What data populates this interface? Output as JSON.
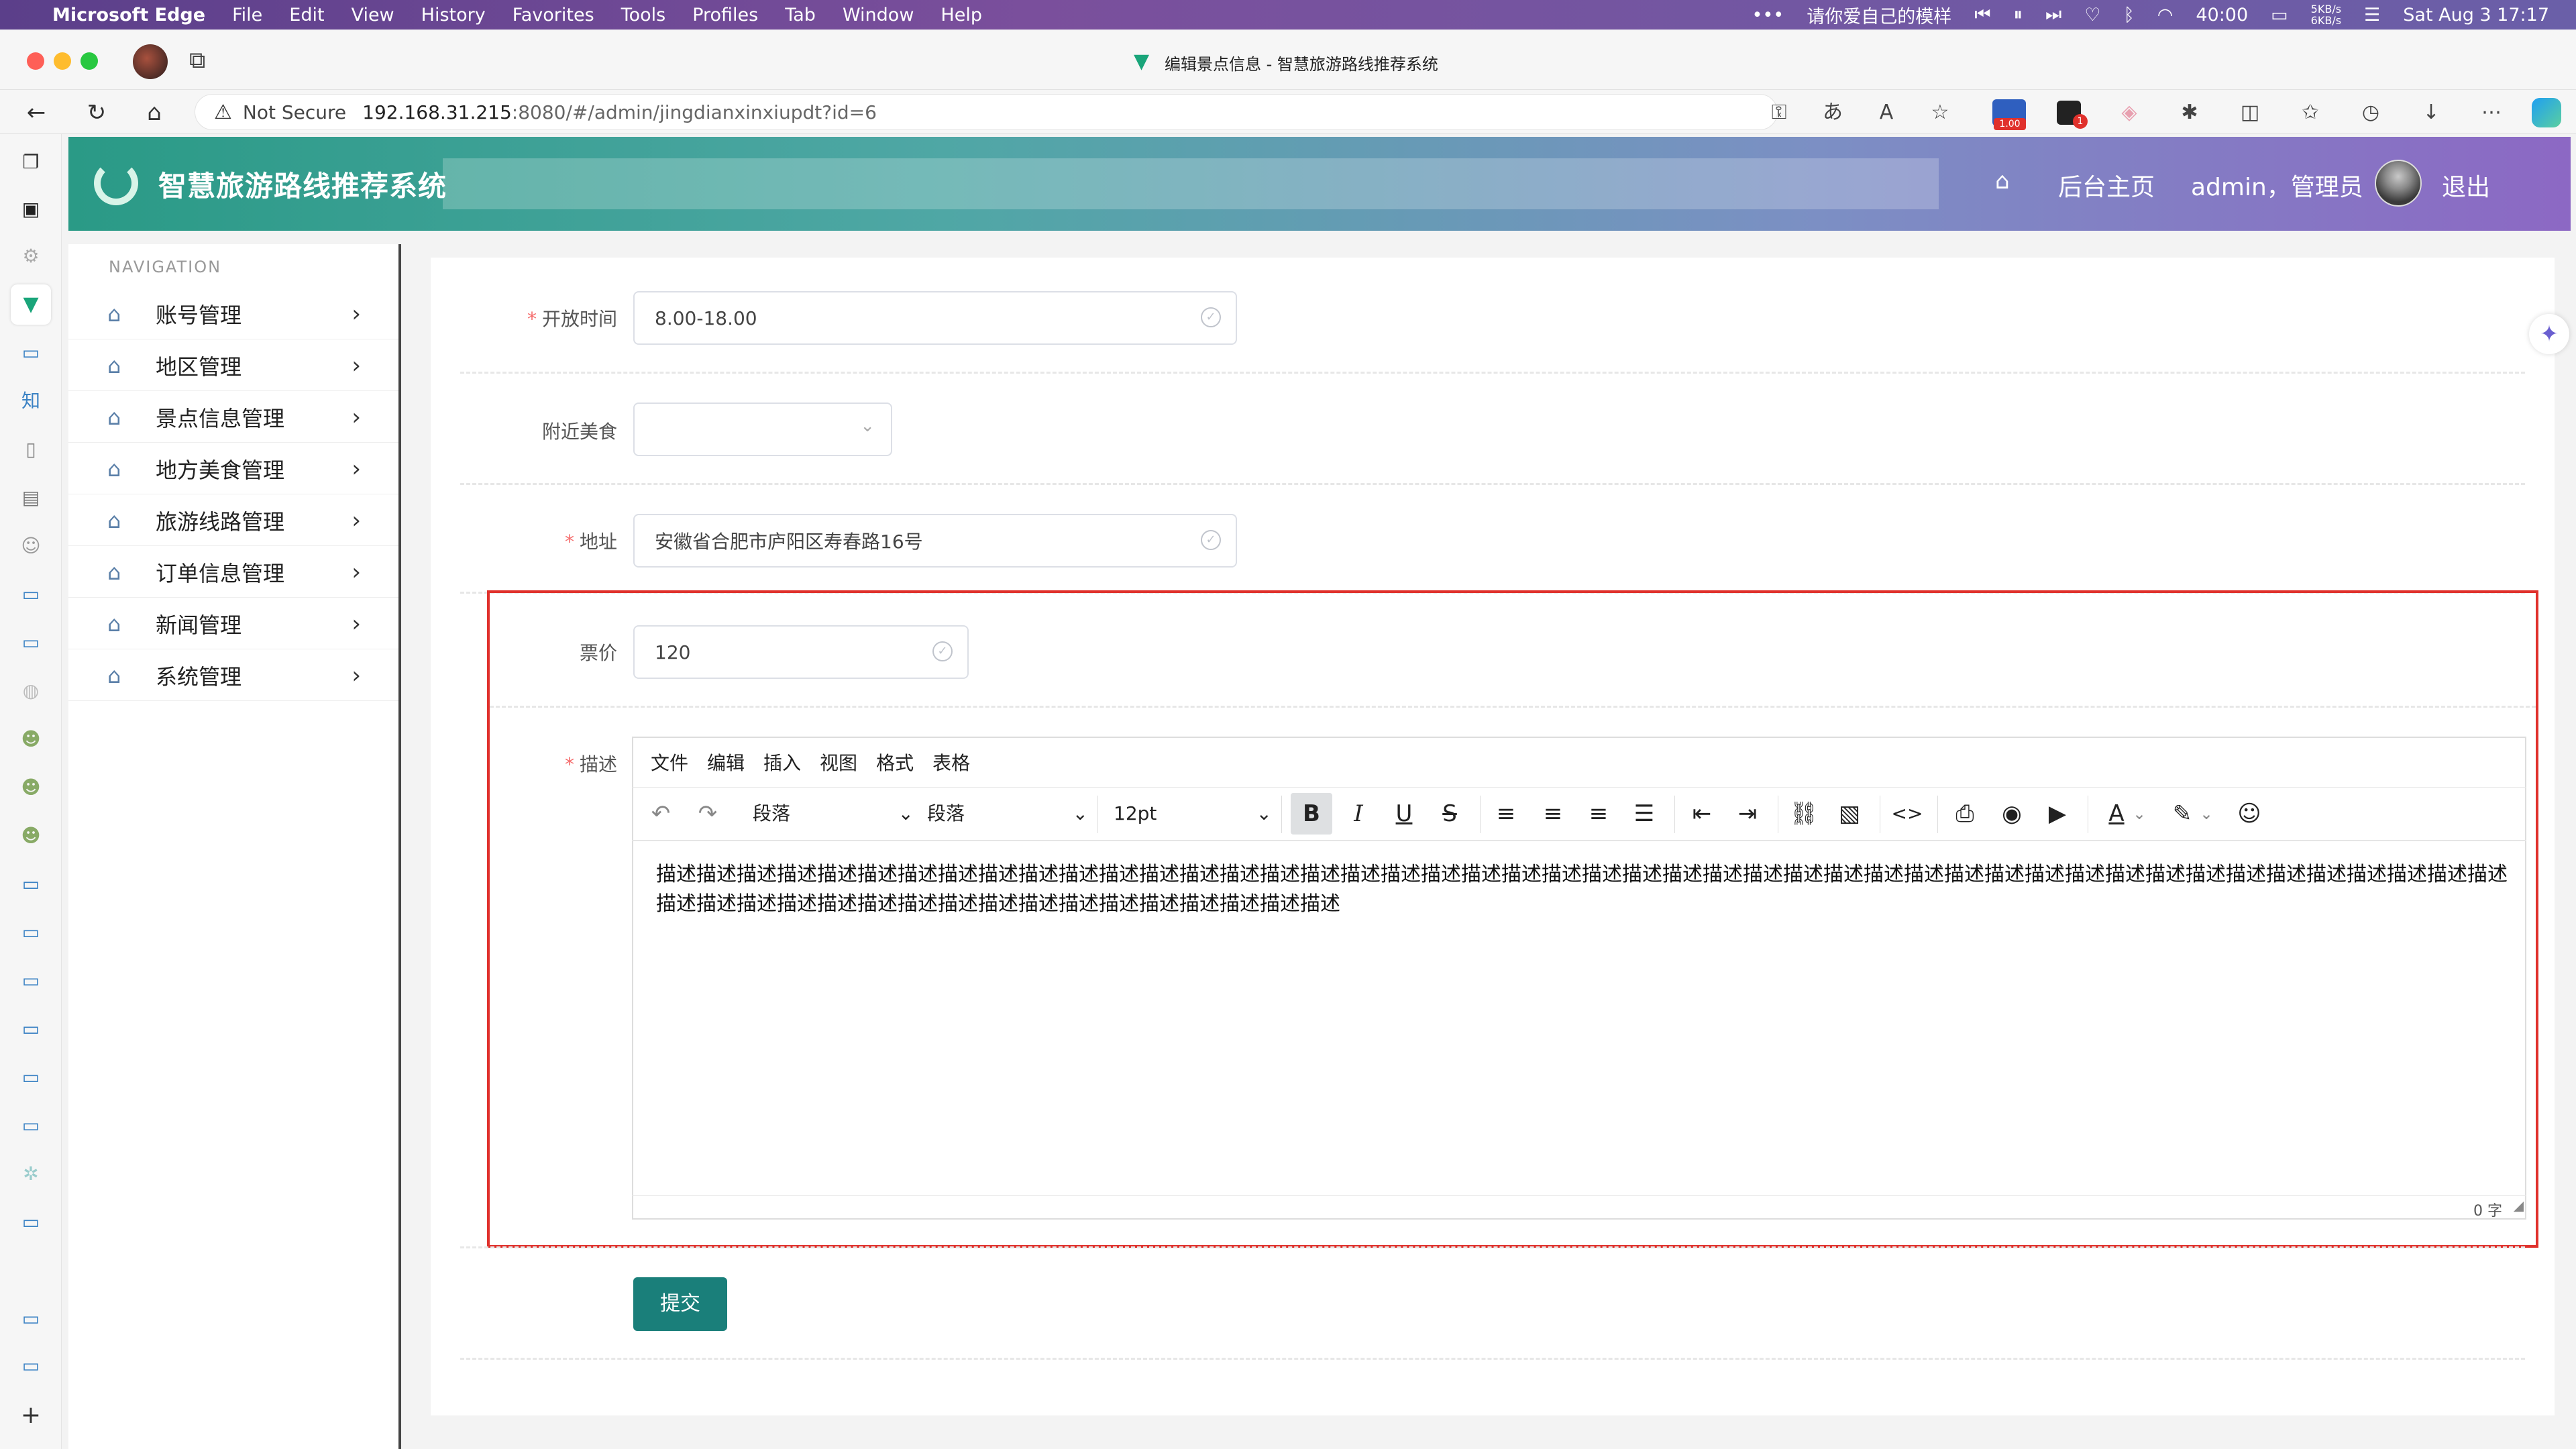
{
  "macos": {
    "app_name": "Microsoft Edge",
    "menus": [
      "File",
      "Edit",
      "View",
      "History",
      "Favorites",
      "Tools",
      "Profiles",
      "Tab",
      "Window",
      "Help"
    ],
    "now_playing": "请你爱自己的模样",
    "timer": "40:00",
    "net_up": "5KB/s",
    "net_down": "6KB/s",
    "datetime": "Sat Aug 3  17:17"
  },
  "browser": {
    "window_title": "编辑景点信息 - 智慧旅游路线推荐系统",
    "not_secure": "Not Secure",
    "url_host": "192.168.31.215",
    "url_rest": ":8080/#/admin/jingdianxinxiupdt?id=6",
    "badge_value": "1.00",
    "ext_badge": "1"
  },
  "app": {
    "brand": "智慧旅游路线推荐系统",
    "home_link": "后台主页",
    "user_label": "admin，管理员",
    "logout": "退出"
  },
  "nav": {
    "caption": "NAVIGATION",
    "items": [
      {
        "label": "账号管理"
      },
      {
        "label": "地区管理"
      },
      {
        "label": "景点信息管理"
      },
      {
        "label": "地方美食管理"
      },
      {
        "label": "旅游线路管理"
      },
      {
        "label": "订单信息管理"
      },
      {
        "label": "新闻管理"
      },
      {
        "label": "系统管理"
      }
    ]
  },
  "form": {
    "open_time": {
      "label": "开放时间",
      "value": "8.00-18.00"
    },
    "food": {
      "label": "附近美食",
      "value": ""
    },
    "address": {
      "label": "地址",
      "value": "安徽省合肥市庐阳区寿春路16号"
    },
    "price": {
      "label": "票价",
      "value": "120"
    },
    "desc": {
      "label": "描述"
    },
    "submit": "提交"
  },
  "editor": {
    "menus": [
      "文件",
      "编辑",
      "插入",
      "视图",
      "格式",
      "表格"
    ],
    "block_format_1": "段落",
    "block_format_2": "段落",
    "font_size": "12pt",
    "content": "描述描述描述描述描述描述描述描述描述描述描述描述描述描述描述描述描述描述描述描述描述描述描述描述描述描述描述描述描述描述描述描述描述描述描述描述描述描述描述描述描述描述描述描述描述描述描述描述描述描述描述描述描述描述描述描述描述描述描述描述描述描述描述",
    "word_count": "0 字"
  }
}
